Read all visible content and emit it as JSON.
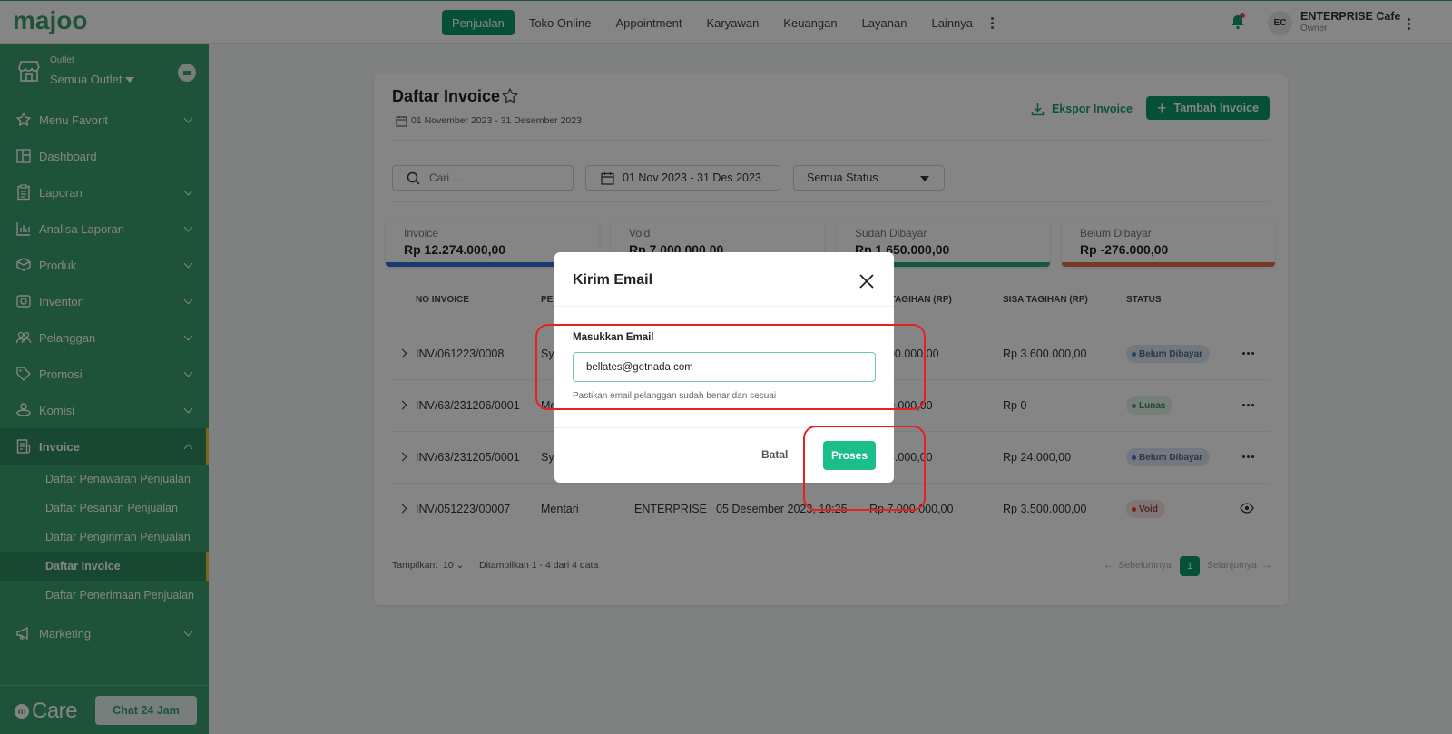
{
  "brand": {
    "logo_text": "majoo",
    "accent": "#0c9a6c",
    "sidebar_bg": "#3a9e6e"
  },
  "topnav": {
    "items": [
      "Penjualan",
      "Toko Online",
      "Appointment",
      "Karyawan",
      "Keuangan",
      "Layanan",
      "Lainnya"
    ],
    "active": "Penjualan"
  },
  "user": {
    "initials": "EC",
    "name": "ENTERPRISE Cafe",
    "role": "Owner"
  },
  "sidebar": {
    "outlet_label": "Outlet",
    "outlet_value": "Semua Outlet",
    "menu": [
      {
        "label": "Menu Favorit",
        "icon": "star-icon"
      },
      {
        "label": "Dashboard",
        "icon": "dashboard-icon"
      },
      {
        "label": "Laporan",
        "icon": "report-icon"
      },
      {
        "label": "Analisa Laporan",
        "icon": "chart-icon"
      },
      {
        "label": "Produk",
        "icon": "box-icon"
      },
      {
        "label": "Inventori",
        "icon": "inventory-icon"
      },
      {
        "label": "Pelanggan",
        "icon": "customers-icon"
      },
      {
        "label": "Promosi",
        "icon": "tag-icon"
      },
      {
        "label": "Komisi",
        "icon": "commission-icon"
      },
      {
        "label": "Invoice",
        "icon": "invoice-icon"
      }
    ],
    "submenu": [
      "Daftar Penawaran Penjualan",
      "Daftar Pesanan Penjualan",
      "Daftar Pengiriman Penjualan",
      "Daftar Invoice",
      "Daftar Penerimaan Penjualan"
    ],
    "submenu_active": "Daftar Invoice",
    "marketing": "Marketing",
    "care_text": "Care",
    "chat_label": "Chat 24 Jam"
  },
  "page": {
    "title": "Daftar Invoice",
    "date_range": "01 November 2023 - 31 Desember 2023",
    "export_label": "Ekspor Invoice",
    "add_label": "Tambah Invoice",
    "search_placeholder": "Cari ...",
    "date_filter": "01 Nov 2023 - 31 Des 2023",
    "status_filter": "Semua Status"
  },
  "stats": [
    {
      "label": "Invoice",
      "value": "Rp 12.274.000,00",
      "color": "#2f6fd6"
    },
    {
      "label": "Void",
      "value": "Rp 7.000.000,00",
      "color": "#d44545"
    },
    {
      "label": "Sudah Dibayar",
      "value": "Rp 1.650.000,00",
      "color": "#2fa77a"
    },
    {
      "label": "Belum Dibayar",
      "value": "Rp -276.000,00",
      "color": "#e0704a"
    }
  ],
  "table": {
    "headers": [
      "NO INVOICE",
      "PEL",
      "L TAGIHAN (RP)",
      "SISA TAGIHAN (RP)",
      "STATUS"
    ],
    "rows": [
      {
        "no": "INV/061223/0008",
        "pelanggan": "Sy",
        "outlet": "",
        "tanggal": "",
        "total": "Rp 3.600.000,00",
        "total_visible": "600.000,00",
        "sisa": "Rp 3.600.000,00",
        "status": "Belum Dibayar"
      },
      {
        "no": "INV/63/231206/0001",
        "pelanggan": "Me",
        "outlet": "",
        "tanggal": "",
        "total_visible": "50.000,00",
        "sisa": "Rp 0",
        "status": "Lunas"
      },
      {
        "no": "INV/63/231205/0001",
        "pelanggan": "Sy",
        "outlet": "",
        "tanggal": "",
        "total_visible": "24.000,00",
        "sisa": "Rp 24.000,00",
        "status": "Belum Dibayar"
      },
      {
        "no": "INV/051223/00007",
        "pelanggan": "Mentari",
        "outlet": "ENTERPRISE",
        "tanggal": "05 Desember 2023, 10:25",
        "total_visible": "Rp 7.000.000,00",
        "sisa": "Rp 3.500.000,00",
        "status": "Void"
      }
    ]
  },
  "footer": {
    "show_label": "Tampilkan:",
    "show_value": "10",
    "count_text": "Ditampilkan 1 - 4 dari 4 data",
    "prev": "Sebelumnya",
    "page": "1",
    "next": "Selanjutnya"
  },
  "modal": {
    "title": "Kirim Email",
    "email_label": "Masukkan Email",
    "email_value": "bellates@getnada.com",
    "hint": "Pastikan email pelanggan sudah benar dan sesuai",
    "cancel": "Batal",
    "submit": "Proses"
  }
}
